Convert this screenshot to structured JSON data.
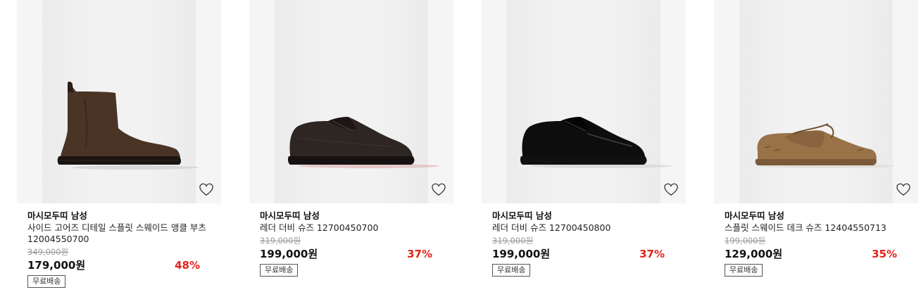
{
  "products": [
    {
      "brand": "마시모두띠 남성",
      "name": "사이드 고어즈 디테일 스플릿 스웨이드 앵클 부츠 12004550700",
      "original_price": "349,000원",
      "price": "179,000원",
      "discount": "48%",
      "shipping": "무료배송",
      "shoe_type": "chelsea-boot",
      "color": "#4a3426"
    },
    {
      "brand": "마시모두띠 남성",
      "name": "레더 더비 슈즈 12700450700",
      "original_price": "319,000원",
      "price": "199,000원",
      "discount": "37%",
      "shipping": "무료배송",
      "shoe_type": "derby",
      "color": "#2e2623"
    },
    {
      "brand": "마시모두띠 남성",
      "name": "레더 더비 슈즈 12700450800",
      "original_price": "319,000원",
      "price": "199,000원",
      "discount": "37%",
      "shipping": "무료배송",
      "shoe_type": "derby",
      "color": "#0d0d0d"
    },
    {
      "brand": "마시모두띠 남성",
      "name": "스플릿 스웨이드 데크 슈즈 12404550713",
      "original_price": "199,000원",
      "price": "129,000원",
      "discount": "35%",
      "shipping": "무료배송",
      "shoe_type": "deck-shoe",
      "color": "#9a7248"
    }
  ],
  "colors": {
    "discount": "#e2231a",
    "image_bg": "#f5f5f5",
    "strike": "#999999"
  },
  "icons": {
    "wishlist": "heart-outline-icon"
  }
}
